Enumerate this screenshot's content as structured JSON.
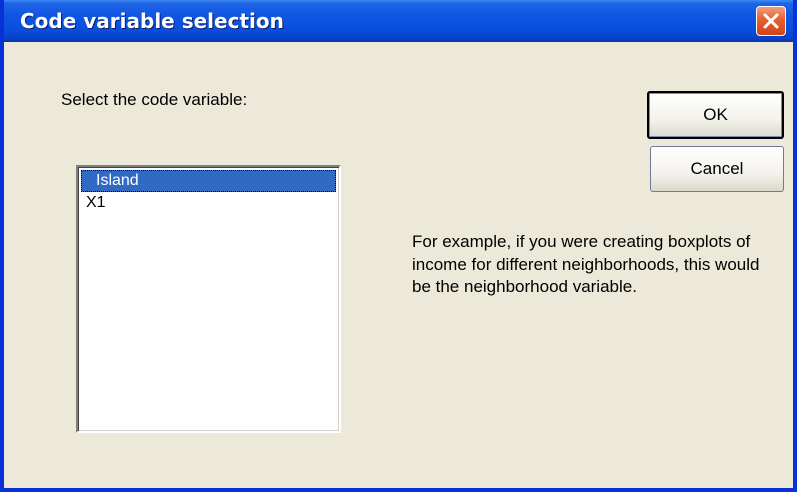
{
  "window": {
    "title": "Code variable selection",
    "close_icon": "close-icon"
  },
  "prompt": {
    "label": "Select the code variable:"
  },
  "variables": {
    "items": [
      "Island",
      "X1"
    ],
    "selected": "Island"
  },
  "buttons": {
    "ok": "OK",
    "cancel": "Cancel"
  },
  "help": {
    "text": "For example, if you were creating boxplots of income for different neighborhoods, this would be the neighborhood variable."
  },
  "colors": {
    "titlebar": "#0a4fdc",
    "dialog_background": "#ece9d8",
    "selection": "#316ac5",
    "close_button": "#e5602f"
  }
}
